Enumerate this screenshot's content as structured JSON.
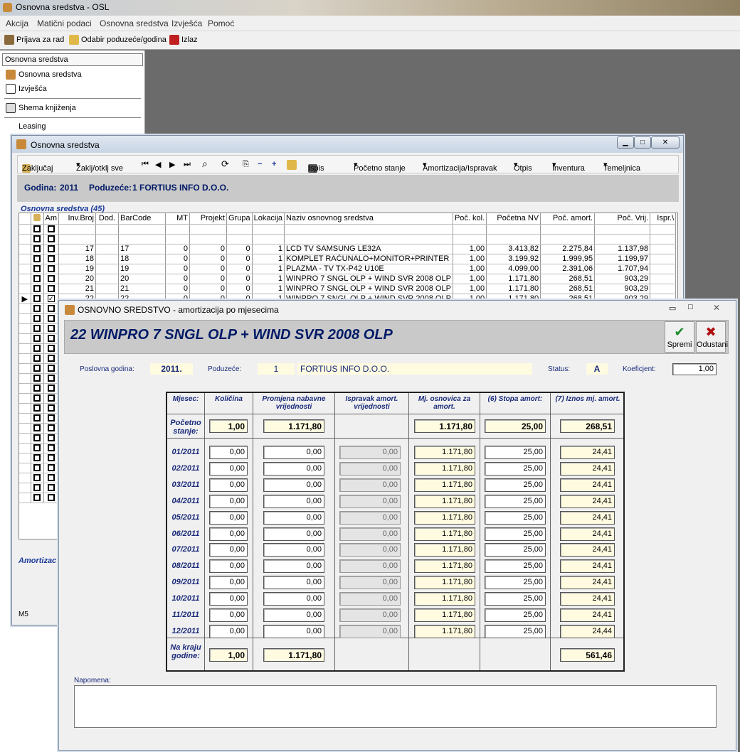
{
  "app": {
    "title": "Osnovna sredstva - OSL"
  },
  "menu": [
    "Akcija",
    "Matični podaci",
    "Osnovna sredstva",
    "Izvješća",
    "Pomoć"
  ],
  "toolbar": {
    "login": "Prijava za rad",
    "select": "Odabir poduzeće/godina",
    "exit": "Izlaz"
  },
  "sidebar": {
    "header": "Osnovna sredstva",
    "items": [
      "Osnovna sredstva",
      "Izvješća",
      "Shema knjiženja",
      "Leasing"
    ]
  },
  "win1": {
    "title": "Osnovna sredstva",
    "tools": [
      "Zaključaj",
      "Zaklj/otklj sve",
      "Ispis",
      "Početno stanje",
      "Amortizacija/Ispravak",
      "Otpis",
      "Inventura",
      "Temeljnica"
    ],
    "godina_label": "Godina:",
    "godina": "2011",
    "poduzece_label": "Poduzeće:",
    "poduzece": "1 FORTIUS INFO D.O.O.",
    "grid_label": "Osnovna sredstva (45)",
    "columns": [
      "Am",
      "Inv.Broj",
      "Dod.",
      "BarCode",
      "MT",
      "Projekt",
      "Grupa",
      "Lokacija",
      "Naziv osnovnog sredstva",
      "Poč. kol.",
      "Početna NV",
      "Poč. amort.",
      "Poč. Vrij.",
      "Ispr.\\"
    ],
    "rows": [
      {
        "inv": "17",
        "bar": "17",
        "mt": "0",
        "proj": "0",
        "grp": "0",
        "lok": "1",
        "naziv": "LCD TV SAMSUNG LE32A",
        "kol": "1,00",
        "nv": "3.413,82",
        "am": "2.275,84",
        "vr": "1.137,98"
      },
      {
        "inv": "18",
        "bar": "18",
        "mt": "0",
        "proj": "0",
        "grp": "0",
        "lok": "1",
        "naziv": "KOMPLET RAČUNALO+MONITOR+PRINTER",
        "kol": "1,00",
        "nv": "3.199,92",
        "am": "1.999,95",
        "vr": "1.199,97"
      },
      {
        "inv": "19",
        "bar": "19",
        "mt": "0",
        "proj": "0",
        "grp": "0",
        "lok": "1",
        "naziv": "PLAZMA - TV TX-P42 U10E",
        "kol": "1,00",
        "nv": "4.099,00",
        "am": "2.391,06",
        "vr": "1.707,94"
      },
      {
        "inv": "20",
        "bar": "20",
        "mt": "0",
        "proj": "0",
        "grp": "0",
        "lok": "1",
        "naziv": "WINPRO 7 SNGL OLP + WIND SVR 2008 OLP",
        "kol": "1,00",
        "nv": "1.171,80",
        "am": "268,51",
        "vr": "903,29"
      },
      {
        "inv": "21",
        "bar": "21",
        "mt": "0",
        "proj": "0",
        "grp": "0",
        "lok": "1",
        "naziv": "WINPRO 7 SNGL OLP + WIND SVR 2008 OLP",
        "kol": "1,00",
        "nv": "1.171,80",
        "am": "268,51",
        "vr": "903,29"
      },
      {
        "inv": "22",
        "bar": "22",
        "mt": "0",
        "proj": "0",
        "grp": "0",
        "lok": "1",
        "naziv": "WINPRO 7 SNGL OLP + WIND SVR 2008 OLP",
        "kol": "1,00",
        "nv": "1.171,80",
        "am": "268,51",
        "vr": "903,29"
      }
    ],
    "bottom_label": "Amortizac",
    "status": "M5"
  },
  "win2": {
    "title": "OSNOVNO SREDSTVO - amortizacija po mjesecima",
    "heading": "22 WINPRO 7 SNGL OLP + WIND SVR 2008 OLP",
    "save": "Spremi",
    "cancel": "Odustani",
    "godina_label": "Poslovna godina:",
    "godina": "2011.",
    "poduzece_label": "Poduzeće:",
    "poduzece_id": "1",
    "poduzece": "FORTIUS INFO D.O.O.",
    "status_label": "Status:",
    "status": "A",
    "koef_label": "Koeficjent:",
    "koef": "1,00",
    "headers": [
      "Mjesec:",
      "Količina",
      "Promjena nabavne vrijednosti",
      "Ispravak amort. vrijednosti",
      "Mj. osnovica za amort.",
      "(6) Stopa amort:",
      "(7) Iznos mj. amort."
    ],
    "pocetno_label": "Početno stanje:",
    "pocetno": {
      "kol": "1,00",
      "nv": "1.171,80",
      "osn": "1.171,80",
      "stopa": "25,00",
      "iznos": "268,51"
    },
    "months": [
      {
        "m": "01/2011",
        "kol": "0,00",
        "nv": "0,00",
        "isp": "0,00",
        "osn": "1.171,80",
        "stopa": "25,00",
        "iznos": "24,41"
      },
      {
        "m": "02/2011",
        "kol": "0,00",
        "nv": "0,00",
        "isp": "0,00",
        "osn": "1.171,80",
        "stopa": "25,00",
        "iznos": "24,41"
      },
      {
        "m": "03/2011",
        "kol": "0,00",
        "nv": "0,00",
        "isp": "0,00",
        "osn": "1.171,80",
        "stopa": "25,00",
        "iznos": "24,41"
      },
      {
        "m": "04/2011",
        "kol": "0,00",
        "nv": "0,00",
        "isp": "0,00",
        "osn": "1.171,80",
        "stopa": "25,00",
        "iznos": "24,41"
      },
      {
        "m": "05/2011",
        "kol": "0,00",
        "nv": "0,00",
        "isp": "0,00",
        "osn": "1.171,80",
        "stopa": "25,00",
        "iznos": "24,41"
      },
      {
        "m": "06/2011",
        "kol": "0,00",
        "nv": "0,00",
        "isp": "0,00",
        "osn": "1.171,80",
        "stopa": "25,00",
        "iznos": "24,41"
      },
      {
        "m": "07/2011",
        "kol": "0,00",
        "nv": "0,00",
        "isp": "0,00",
        "osn": "1.171,80",
        "stopa": "25,00",
        "iznos": "24,41"
      },
      {
        "m": "08/2011",
        "kol": "0,00",
        "nv": "0,00",
        "isp": "0,00",
        "osn": "1.171,80",
        "stopa": "25,00",
        "iznos": "24,41"
      },
      {
        "m": "09/2011",
        "kol": "0,00",
        "nv": "0,00",
        "isp": "0,00",
        "osn": "1.171,80",
        "stopa": "25,00",
        "iznos": "24,41"
      },
      {
        "m": "10/2011",
        "kol": "0,00",
        "nv": "0,00",
        "isp": "0,00",
        "osn": "1.171,80",
        "stopa": "25,00",
        "iznos": "24,41"
      },
      {
        "m": "11/2011",
        "kol": "0,00",
        "nv": "0,00",
        "isp": "0,00",
        "osn": "1.171,80",
        "stopa": "25,00",
        "iznos": "24,41"
      },
      {
        "m": "12/2011",
        "kol": "0,00",
        "nv": "0,00",
        "isp": "0,00",
        "osn": "1.171,80",
        "stopa": "25,00",
        "iznos": "24,44"
      }
    ],
    "kraj_label": "Na kraju godine:",
    "kraj": {
      "kol": "1,00",
      "nv": "1.171,80",
      "iznos": "561,46"
    },
    "napomena_label": "Napomena:"
  }
}
